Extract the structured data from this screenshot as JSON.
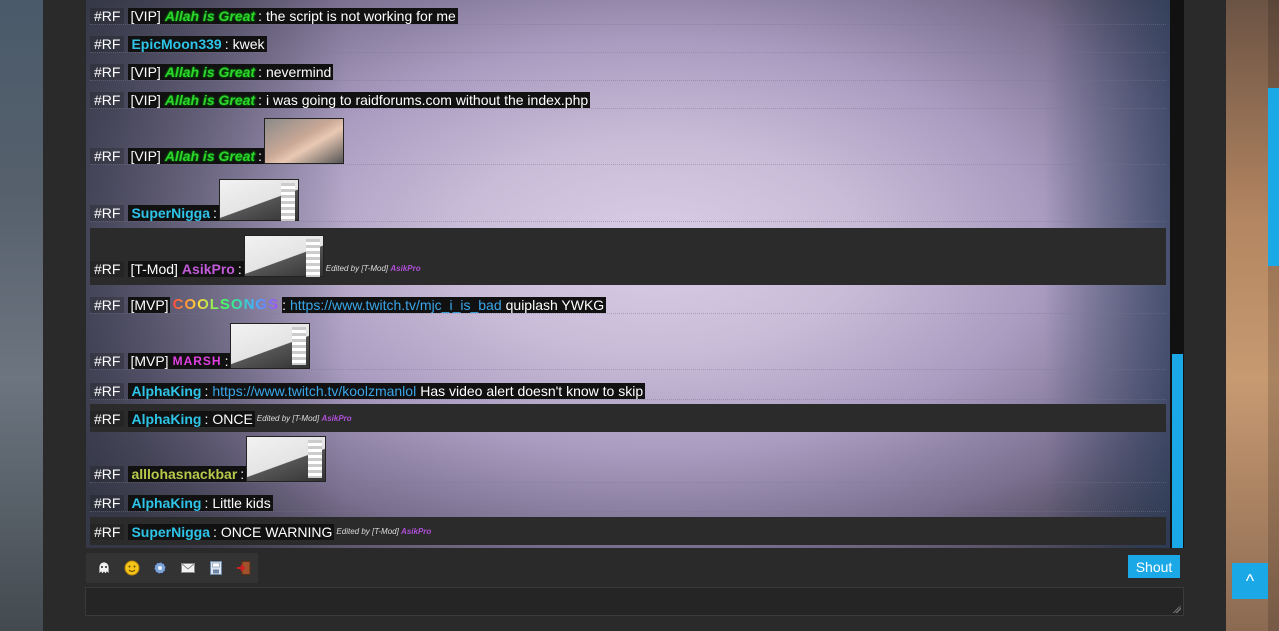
{
  "chat": {
    "messages": [
      {
        "tag": "#RF",
        "rank": "[VIP]",
        "user": "Allah is Great",
        "text": "the script is not working for me"
      },
      {
        "tag": "#RF",
        "rank": "",
        "user": "EpicMoon339",
        "text": "kwek"
      },
      {
        "tag": "#RF",
        "rank": "[VIP]",
        "user": "Allah is Great",
        "text": "nevermind"
      },
      {
        "tag": "#RF",
        "rank": "[VIP]",
        "user": "Allah is Great",
        "text": "i was going to raidforums.com without the index.php"
      },
      {
        "tag": "#RF",
        "rank": "[VIP]",
        "user": "Allah is Great",
        "text": ""
      },
      {
        "tag": "#RF",
        "rank": "",
        "user": "SuperNigga",
        "text": ""
      },
      {
        "tag": "#RF",
        "rank": "[T-Mod]",
        "user": "AsikPro",
        "text": "",
        "edited_prefix": "Edited by [T-Mod]",
        "edited_by": "AsikPro"
      },
      {
        "tag": "#RF",
        "rank": "[MVP]",
        "user": "COOLSONGS",
        "link": "https://www.twitch.tv/mjc_i_is_bad",
        "text": "quiplash YWKG"
      },
      {
        "tag": "#RF",
        "rank": "[MVP]",
        "user": "MARSH",
        "text": ""
      },
      {
        "tag": "#RF",
        "rank": "",
        "user": "AlphaKing",
        "link": "https://www.twitch.tv/koolzmanlol",
        "text": "Has video alert doesn't know to skip"
      },
      {
        "tag": "#RF",
        "rank": "",
        "user": "AlphaKing",
        "text": "ONCE",
        "edited_prefix": "Edited by [T-Mod]",
        "edited_by": "AsikPro"
      },
      {
        "tag": "#RF",
        "rank": "",
        "user": "alllohasnackbar",
        "text": ""
      },
      {
        "tag": "#RF",
        "rank": "",
        "user": "AlphaKing",
        "text": "Little kids"
      },
      {
        "tag": "#RF",
        "rank": "",
        "user": "SuperNigga",
        "text": "ONCE WARNING",
        "edited_prefix": "Edited by [T-Mod]",
        "edited_by": "AsikPro"
      }
    ],
    "colon": ":"
  },
  "toolbar": {
    "icons": [
      "ghost-icon",
      "smiley-icon",
      "settings-icon",
      "mail-icon",
      "save-icon",
      "exit-icon"
    ]
  },
  "shout": {
    "button_label": "Shout"
  },
  "back_to_top": {
    "glyph": "^"
  },
  "colors": {
    "accent": "#1aa8e6",
    "panel": "#2a2a2a"
  }
}
